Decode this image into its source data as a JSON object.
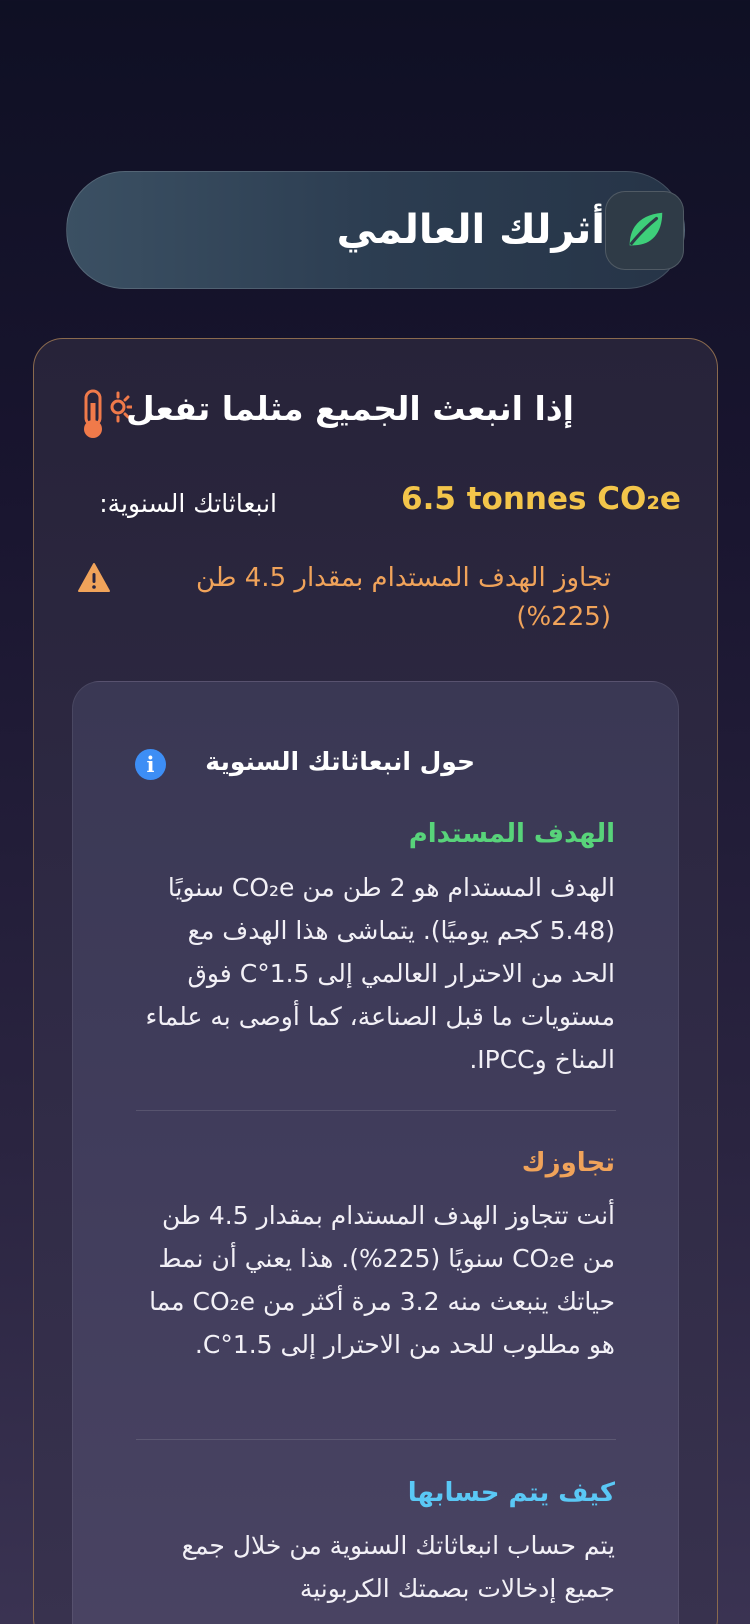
{
  "header": {
    "title": "أثرلك العالمي",
    "logo_icon": "leaf-icon",
    "logo_color": "#3ecf7a"
  },
  "card": {
    "title": "إذا انبعث الجميع مثلما تفعل",
    "title_icon": "thermometer-sun-icon",
    "emissions_label": "انبعاثاتك السنوية:",
    "emissions_value": "6.5 tonnes CO₂e",
    "warning_icon": "warning-icon",
    "warning_text": "تجاوز الهدف المستدام بمقدار 4.5 طن (225%)",
    "accent_color": "#f3c54a",
    "warning_color": "#f0a35a"
  },
  "info": {
    "title": "حول انبعاثاتك السنوية",
    "info_icon": "info-icon",
    "sections": [
      {
        "heading": "الهدف المستدام",
        "color": "#58d37a",
        "body": "الهدف المستدام هو 2 طن من CO₂e سنويًا (5.48 كجم يوميًا). يتماشى هذا الهدف مع الحد من الاحترار العالمي إلى 1.5°C فوق مستويات ما قبل الصناعة، كما أوصى به علماء المناخ وIPCC."
      },
      {
        "heading": "تجاوزك",
        "color": "#f0a35a",
        "body": "أنت تتجاوز الهدف المستدام بمقدار 4.5 طن من CO₂e سنويًا (225%). هذا يعني أن نمط حياتك ينبعث منه 3.2 مرة أكثر من CO₂e مما هو مطلوب للحد من الاحترار إلى 1.5°C."
      },
      {
        "heading": "كيف يتم حسابها",
        "color": "#5ac8f5",
        "body": "يتم حساب انبعاثاتك السنوية من خلال جمع جميع إدخالات بصمتك الكربونية"
      }
    ]
  }
}
